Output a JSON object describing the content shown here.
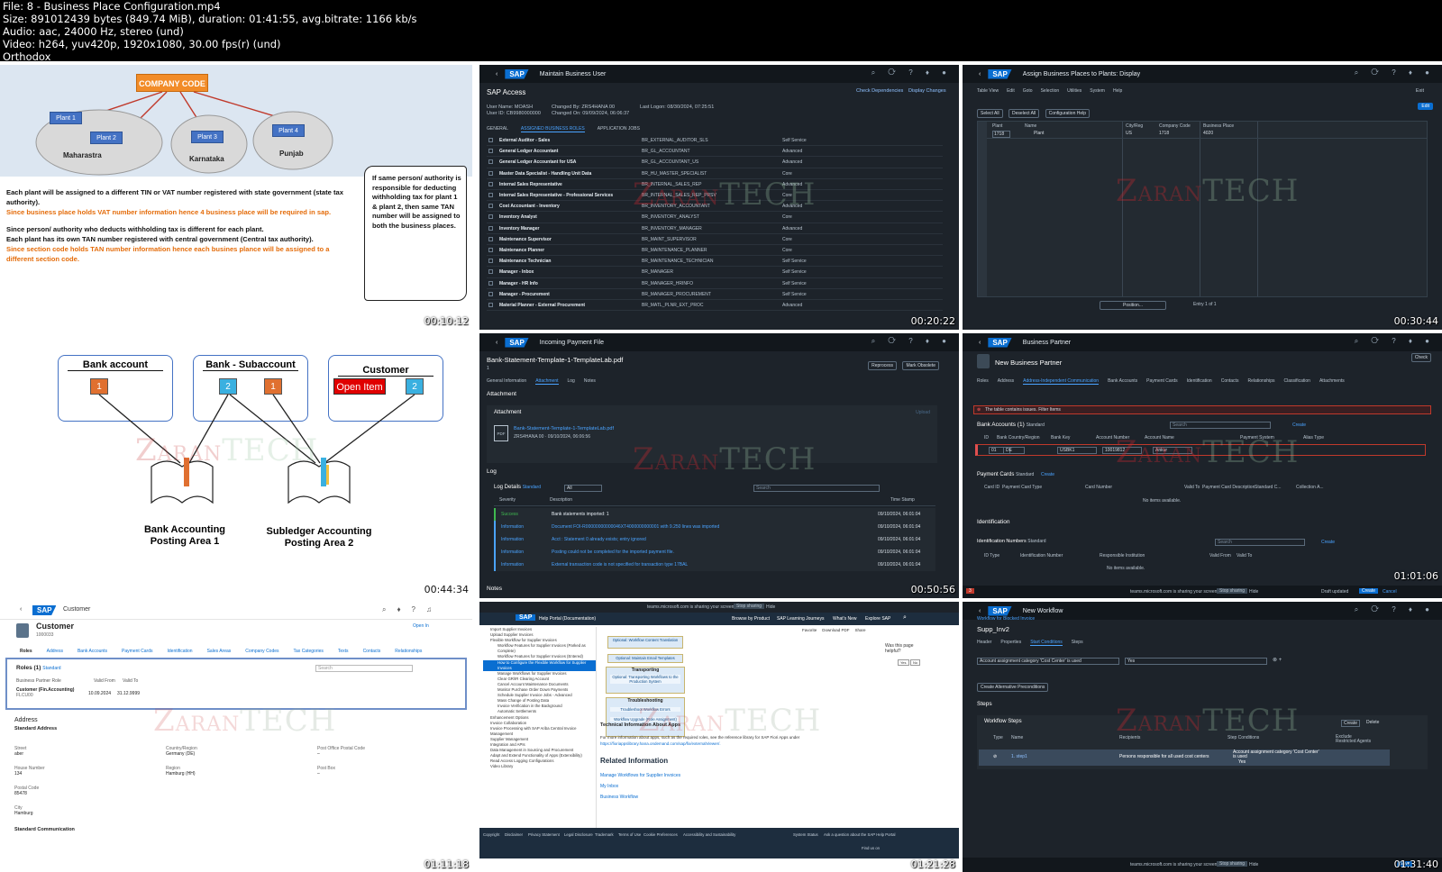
{
  "header": {
    "lines": [
      "File: 8 - Business Place Configuration.mp4",
      "Size: 891012439 bytes (849.74 MiB), duration: 01:41:55, avg.bitrate: 1166 kb/s",
      "Audio: aac, 24000 Hz, stereo (und)",
      "Video: h264, yuv420p, 1920x1080, 30.00 fps(r) (und)",
      "Orthodox"
    ]
  },
  "watermark": {
    "z": "Z",
    "rest": "ARAN",
    "tech": "TECH"
  },
  "t1": {
    "timestamp": "00:10:12",
    "company": "COMPANY CODE",
    "plants": [
      "Plant 1",
      "Plant 2",
      "Plant 3",
      "Plant 4"
    ],
    "states": [
      "Maharastra",
      "Karnataka",
      "Punjab"
    ],
    "black1": "Each plant will be assigned to a different TIN or VAT number registered with state government (state tax authority).",
    "orange1": "Since business place holds VAT  number information hence 4 business place will be required in sap.",
    "black2": "Since person/ authority who deducts withholding tax is different for each plant.",
    "black3": "Each plant has its own TAN number registered with central government (Central tax authority).",
    "orange2": "Since section code holds TAN number information hence each busines plance will be assigned to a different section code.",
    "scroll": "If same person/ authority is responsible for deducting withholding tax for plant 1 & plant 2, then same TAN number will be assigned to both the business places."
  },
  "t2": {
    "timestamp": "00:20:22",
    "app": "Maintain Business User",
    "title": "SAP Access",
    "check": "Check Dependencies",
    "display": "Display Changes",
    "user": "User Name: MOASH",
    "userid": "User ID: CB9980000000",
    "changedby": "Changed By: ZRS4HANA 00",
    "changedon": "Changed On: 09/09/2024, 06:06:37",
    "lastlogon": "Last Logon: 08/30/2024, 07:25:51",
    "tabs": [
      "GENERAL",
      "ASSIGNED BUSINESS ROLES",
      "APPLICATION JOBS"
    ],
    "rows": [
      [
        "External Auditor - Sales",
        "BR_EXTERNAL_AUDITOR_SLS",
        "Self Service"
      ],
      [
        "General Ledger Accountant",
        "BR_GL_ACCOUNTANT",
        "Advanced"
      ],
      [
        "General Ledger Accountant for USA",
        "BR_GL_ACCOUNTANT_US",
        "Advanced"
      ],
      [
        "Master Data Specialist - Handling Unit Data",
        "BR_HU_MASTER_SPECIALIST",
        "Core"
      ],
      [
        "Internal Sales Representative",
        "BR_INTERNAL_SALES_REP",
        "Advanced"
      ],
      [
        "Internal Sales Representative - Professional Services",
        "BR_INTERNAL_SALES_REP_PRSV",
        "Core"
      ],
      [
        "Cost Accountant - Inventory",
        "BR_INVENTORY_ACCOUNTANT",
        "Advanced"
      ],
      [
        "Inventory Analyst",
        "BR_INVENTORY_ANALYST",
        "Core"
      ],
      [
        "Inventory Manager",
        "BR_INVENTORY_MANAGER",
        "Advanced"
      ],
      [
        "Maintenance Supervisor",
        "BR_MAINT_SUPERVISOR",
        "Core"
      ],
      [
        "Maintenance Planner",
        "BR_MAINTENANCE_PLANNER",
        "Core"
      ],
      [
        "Maintenance Technician",
        "BR_MAINTENANCE_TECHNICIAN",
        "Self Service"
      ],
      [
        "Manager - Inbox",
        "BR_MANAGER",
        "Self Service"
      ],
      [
        "Manager - HR Info",
        "BR_MANAGER_HRINFO",
        "Self Service"
      ],
      [
        "Manager - Procurement",
        "BR_MANAGER_PROCUREMENT",
        "Self Service"
      ],
      [
        "Material Planner - External Procurement",
        "BR_MATL_PLNR_EXT_PROC",
        "Advanced"
      ]
    ]
  },
  "t3": {
    "timestamp": "00:30:44",
    "app": "Assign Business Places to Plants: Display",
    "menu": [
      "Table View",
      "Edit",
      "Goto",
      "Selection",
      "Utilities",
      "System",
      "Help"
    ],
    "exit": "Exit",
    "buttons": [
      "Select All",
      "Deselect All",
      "Configuration Help"
    ],
    "edit": "Edit",
    "cols": [
      "Plant",
      "Name",
      "City/Reg",
      "Company Code",
      "Business Place"
    ],
    "row": [
      "1718",
      "Plant",
      "US",
      "1718",
      "4020"
    ],
    "position": "Position...",
    "entry": "Entry 1 of 1"
  },
  "t4": {
    "timestamp": "00:44:34",
    "boxes": [
      "Bank account",
      "Bank - Subaccount",
      "Customer"
    ],
    "nums": [
      "1",
      "2",
      "1",
      "2"
    ],
    "openitem": "Open Item",
    "book1": "Bank Accounting Posting Area 1",
    "book2": "Subledger Accounting Posting Area 2"
  },
  "t5": {
    "timestamp": "00:50:56",
    "app": "Incoming Payment File",
    "file": "Bank-Statement-Template-1-TemplateLab.pdf",
    "num": "1",
    "btns": [
      "Reprocess",
      "Mark Obsolete"
    ],
    "tabs": [
      "General Information",
      "Attachment",
      "Log",
      "Notes"
    ],
    "attachh": "Attachment",
    "attach": "Attachment",
    "upload": "Upload",
    "pdfname": "Bank-Statement-Template-1-TemplateLab.pdf",
    "pdfmeta": "ZRS4HANA 00 · 09/10/2024, 06:06:56",
    "log": "Log",
    "logdetails": "Log Details",
    "std": "Standard",
    "all": "All",
    "search": "Search",
    "cols": [
      "Severity",
      "Description",
      "Time Stamp"
    ],
    "rows": [
      [
        "Success",
        "Bank statements imported: 1",
        "09/10/2024, 06:01:04"
      ],
      [
        "Information",
        "Document FOI-R00000000000046XT4000000000001 with 9.250 lines was imported",
        "09/10/2024, 06:01:04"
      ],
      [
        "Information",
        "Acct : Statement 0 already exists; entry ignored",
        "09/10/2024, 06:01:04"
      ],
      [
        "Information",
        "Posting could not be completed for the imported payment file.",
        "09/10/2024, 06:01:04"
      ],
      [
        "Information",
        "External transaction code is not specified for transaction type 17BAL",
        "09/10/2024, 06:01:04"
      ]
    ],
    "notes": "Notes"
  },
  "t6": {
    "timestamp": "01:01:06",
    "app": "Business Partner",
    "title": "New Business Partner",
    "check": "Check",
    "tabs": [
      "Roles",
      "Address",
      "Address-Independent Communication",
      "Bank Accounts",
      "Payment Cards",
      "Identification",
      "Contacts",
      "Relationships",
      "Classification",
      "Attachments"
    ],
    "error": "The table contains issues. Filter Items",
    "bank": "Bank Accounts (1)",
    "std": "Standard",
    "search": "Search",
    "create": "Create",
    "delete": "Delete",
    "copy": "Copy",
    "bankcols": [
      "ID",
      "Bank Country/Region",
      "Bank Key",
      "Account Number",
      "Account Name",
      "Payment System",
      "Alias Type"
    ],
    "bankrow": [
      "01",
      "DE",
      "USBK1",
      "10019812",
      "Ankur"
    ],
    "cards": "Payment Cards",
    "cardcols": [
      "Card ID",
      "Payment Card Type",
      "Card Number",
      "Valid To",
      "Payment Card Description",
      "Standard C...",
      "Collection A..."
    ],
    "noitems": "No items available.",
    "ident": "Identification",
    "identnum": "Identification Numbers",
    "identcols": [
      "ID Type",
      "Identification Number",
      "Responsible Institution",
      "Valid From",
      "Valid To"
    ],
    "teams": "teams.microsoft.com is sharing your screen.",
    "stop": "Stop sharing",
    "hide": "Hide",
    "draft": "Draft updated",
    "createb": "Create",
    "cancel": "Cancel",
    "count": "3"
  },
  "t7": {
    "timestamp": "01:11:18",
    "app": "Customer",
    "title": "Customer",
    "id": "1000033",
    "openin": "Open In",
    "tabs": [
      "Roles",
      "Address",
      "Bank Accounts",
      "Payment Cards",
      "Identification",
      "Sales Areas",
      "Company Codes",
      "Tax Categories",
      "Texts",
      "Contacts",
      "Relationships"
    ],
    "roles": "Roles (1)",
    "std": "Standard",
    "search": "Search",
    "rcols": [
      "Business Partner Role",
      "Valid From",
      "Valid To"
    ],
    "rrow": [
      "Customer (Fin.Accounting)",
      "FLCU00",
      "10.09.2024",
      "31.12.9999"
    ],
    "address": "Address",
    "stdaddr": "Standard Address",
    "fields": [
      [
        "Street",
        "aber"
      ],
      [
        "Country/Region",
        "Germany (DE)"
      ],
      [
        "Post Office Postal Code",
        "–"
      ],
      [
        "House Number",
        "134"
      ],
      [
        "Region",
        "Hamburg (HH)"
      ],
      [
        "Post Box",
        "–"
      ],
      [
        "Postal Code",
        "85478"
      ],
      [
        "City",
        "Hamburg"
      ]
    ],
    "stdcomm": "Standard Communication"
  },
  "t8": {
    "timestamp": "01:21:28",
    "teams": "teams.microsoft.com is sharing your screen.",
    "stop": "Stop sharing",
    "hide": "Hide",
    "portal": "Help Portal (Documentation)",
    "nav": [
      "Browse by Product",
      "SAP Learning Journeys",
      "What's New",
      "Explore SAP"
    ],
    "tools": [
      "Favorite",
      "Download PDF",
      "Share"
    ],
    "tree": [
      "Import Supplier Invoices",
      "Upload Supplier Invoices",
      "Flexible Workflow for Supplier Invoices",
      "Workflow Features for Supplier Invoices (Parked as Complete)",
      "Workflow Features for Supplier Invoices (Entered)",
      "How to Configure the Flexible Workflow for Supplier Invoices",
      "Manage Workflows for Supplier Invoices",
      "Clear GR/IR Clearing Account",
      "Cancel Account Maintenance Documents",
      "Monitor Purchase Order Down Payments",
      "Schedule Supplier Invoice Jobs - Advanced",
      "Mass Change of Posting Data",
      "Invoice Verification in the Background",
      "Automatic Settlements",
      "Enhancement Options",
      "Invoice Collaboration",
      "Invoice Processing with SAP Ariba Central Invoice Management",
      "Supplier Management",
      "Integration and APIs",
      "Data Management in Sourcing and Procurement",
      "Adapt and Extend Functionality of Apps (Extensibility)",
      "Read Access Logging Configurations",
      "Video Library"
    ],
    "flow": [
      "Optional: Workflow Content Translation",
      "Optional: Maintain Email Templates",
      "Transporting",
      "Optional: Transporting Workflows to the Production System",
      "Troubleshooting",
      "Troubleshoot Workflow Errors",
      "Workflow Upgrade (Role Assignment)"
    ],
    "helpful": "Was this page helpful?",
    "yes": "Yes",
    "no": "No",
    "techh": "Technical Information About Apps",
    "techp": "For more information about apps, such as the required roles, see the reference library for SAP Fiori Apps under",
    "link": "https://fioriappslibrary.hana.ondemand.com/sap/fix/externalViewer/.",
    "related": "Related Information",
    "rel": [
      "Manage Workflows for Supplier Invoices",
      "My Inbox",
      "Business Workflow"
    ],
    "footer": [
      "Copyright",
      "Disclaimer",
      "Privacy Statement",
      "Legal Disclosure",
      "Trademark",
      "Terms of Use",
      "Cookie Preferences",
      "Accessibility and Sustainability",
      "System Status",
      "Ask a question about the SAP Help Portal"
    ],
    "findus": "Find us on"
  },
  "t9": {
    "timestamp": "01:31:40",
    "app": "New Workflow",
    "crumb": "Workflow for Blocked Invoice",
    "title": "Supp_Inv2",
    "tabs": [
      "Header",
      "Properties",
      "Start Conditions",
      "Steps"
    ],
    "cond": "Account assignment category 'Cost Center' is used",
    "yes": "Yes",
    "altbtn": "Create Alternative Preconditions",
    "steps": "Steps",
    "wsteps": "Workflow Steps",
    "create": "Create",
    "delete": "Delete",
    "cols": [
      "Type",
      "Name",
      "Recipients",
      "Step Conditions",
      "Exclude Restricted Agents"
    ],
    "row": [
      "1. step1",
      "Persons responsible for all used cost centers",
      "Account assignment category 'Cost Center' is used",
      "Yes"
    ],
    "teams": "teams.microsoft.com is sharing your screen.",
    "stop": "Stop sharing",
    "hide": "Hide",
    "save": "Save"
  }
}
